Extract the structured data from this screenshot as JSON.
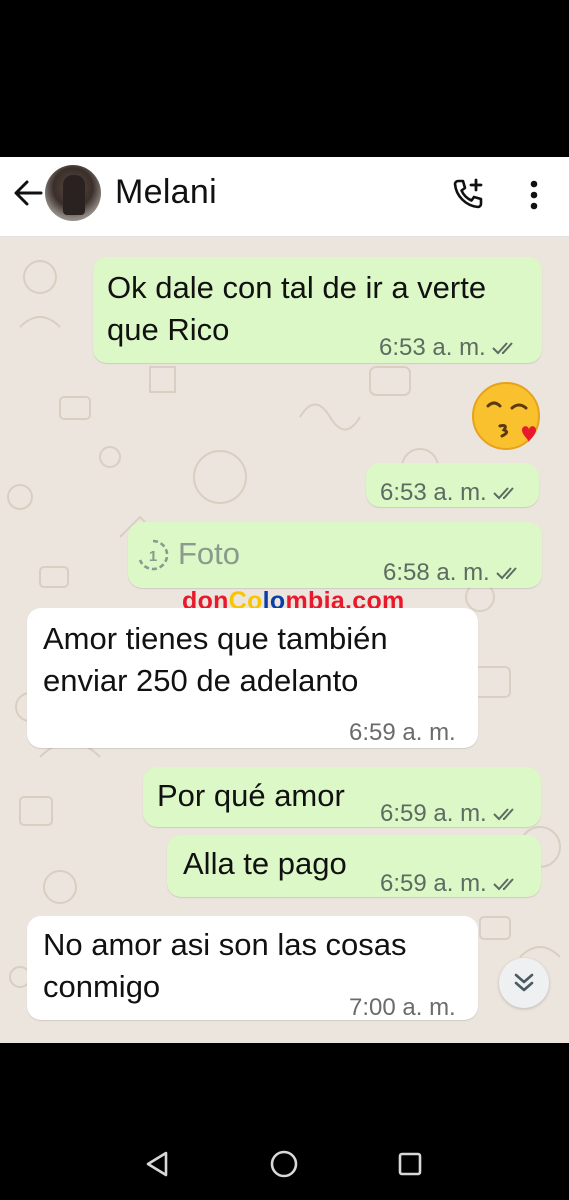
{
  "header": {
    "contact_name": "Melani",
    "back_icon": "arrow-left-icon",
    "call_icon": "add-call-icon",
    "menu_icon": "more-vert-icon"
  },
  "messages": [
    {
      "direction": "out",
      "text_lines": [
        "Ok dale con tal de ir a verte",
        "que Rico"
      ],
      "time": "6:53 a. m.",
      "status": "read"
    },
    {
      "direction": "out",
      "emoji": "😘",
      "time": "6:53 a. m.",
      "status": "read"
    },
    {
      "direction": "out",
      "text": "Foto",
      "icon": "view-once-icon",
      "time": "6:58 a. m.",
      "status": "read"
    },
    {
      "direction": "in",
      "text_lines": [
        "Amor tienes que también",
        "enviar 250 de adelanto"
      ],
      "time": "6:59 a. m."
    },
    {
      "direction": "out",
      "text": "Por qué amor",
      "time": "6:59 a. m.",
      "status": "read"
    },
    {
      "direction": "out",
      "text": "Alla te pago",
      "time": "6:59 a. m.",
      "status": "read"
    },
    {
      "direction": "in",
      "text_lines": [
        "No amor asi son las cosas",
        "conmigo"
      ],
      "time": "7:00 a. m."
    }
  ],
  "watermark": {
    "parts": [
      {
        "text": "don",
        "color": "#e8192c"
      },
      {
        "text": "Co",
        "color": "#f7c600"
      },
      {
        "text": "lo",
        "color": "#0a3fa8"
      },
      {
        "text": "mbia.com",
        "color": "#e8192c"
      }
    ]
  },
  "colors": {
    "outgoing_bubble": "#dcf8c6",
    "incoming_bubble": "#ffffff",
    "chat_background": "#ece5dd",
    "read_tick": "#5e6b63"
  },
  "nav": {
    "back_icon": "triangle-back-icon",
    "home_icon": "circle-home-icon",
    "recents_icon": "square-recents-icon"
  }
}
